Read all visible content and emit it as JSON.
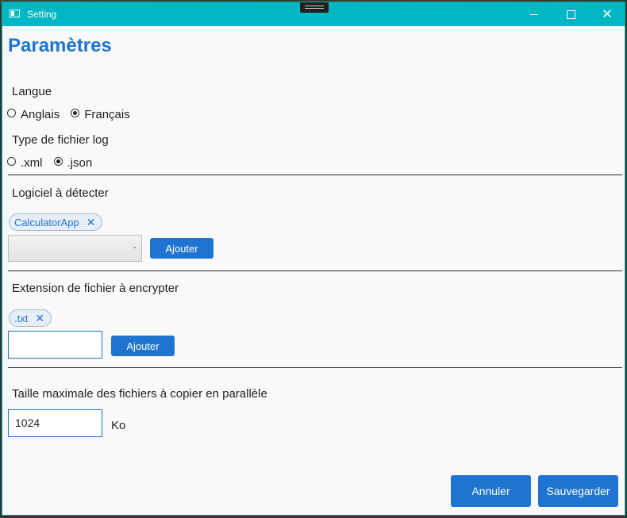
{
  "window": {
    "title": "Setting"
  },
  "page": {
    "title": "Paramètres"
  },
  "language": {
    "label": "Langue",
    "options": [
      {
        "label": "Anglais",
        "checked": false
      },
      {
        "label": "Français",
        "checked": true
      }
    ]
  },
  "log_type": {
    "label": "Type de fichier log",
    "options": [
      {
        "label": ".xml",
        "checked": false
      },
      {
        "label": ".json",
        "checked": true
      }
    ]
  },
  "software": {
    "label": "Logiciel à détecter",
    "chips": [
      "CalculatorApp"
    ],
    "select_value": "",
    "add_label": "Ajouter"
  },
  "extension": {
    "label": "Extension de fichier à encrypter",
    "chips": [
      ".txt"
    ],
    "input_value": "",
    "add_label": "Ajouter"
  },
  "max_size": {
    "label": "Taille maximale des fichiers à copier en parallèle",
    "value": "1024",
    "unit": "Ko"
  },
  "footer": {
    "cancel_label": "Annuler",
    "save_label": "Sauvegarder"
  },
  "colors": {
    "accent": "#1e74d0",
    "titlebar": "#00b7c3"
  }
}
